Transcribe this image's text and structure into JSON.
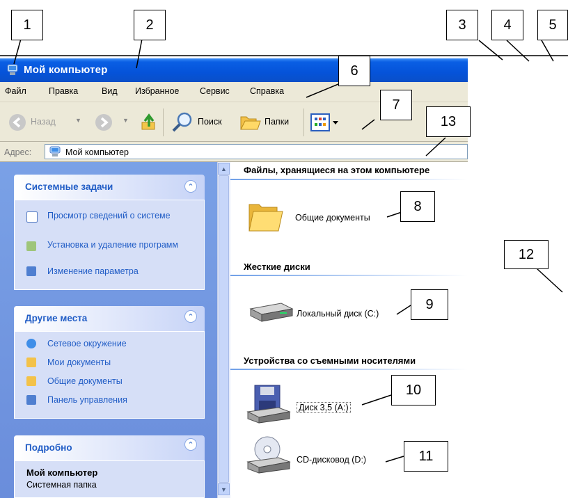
{
  "callouts": [
    "1",
    "2",
    "3",
    "4",
    "5",
    "6",
    "7",
    "8",
    "9",
    "10",
    "11",
    "12",
    "13"
  ],
  "window": {
    "title": "Мой компьютер",
    "menu": [
      "Файл",
      "Правка",
      "Вид",
      "Избранное",
      "Сервис",
      "Справка"
    ],
    "toolbar": {
      "back": "Назад",
      "search": "Поиск",
      "folders": "Папки"
    },
    "address_label": "Адрес:",
    "address_value": "Мой компьютер"
  },
  "tasks": {
    "system": {
      "title": "Системные задачи",
      "items": [
        "Просмотр сведений о системе",
        "Установка и удаление программ",
        "Изменение параметра"
      ]
    },
    "other": {
      "title": "Другие места",
      "items": [
        "Сетевое окружение",
        "Мои документы",
        "Общие документы",
        "Панель управления"
      ]
    },
    "details": {
      "title": "Подробно",
      "name": "Мой компьютер",
      "type": "Системная папка"
    }
  },
  "content": {
    "groups": [
      {
        "title": "Файлы, хранящиеся на этом компьютере",
        "items": [
          "Общие документы"
        ]
      },
      {
        "title": "Жесткие диски",
        "items": [
          "Локальный диск (C:)"
        ]
      },
      {
        "title": "Устройства со съемными носителями",
        "items": [
          "Диск 3,5 (A:)",
          "CD-дисковод (D:)"
        ]
      }
    ]
  },
  "colors": {
    "titlebar": "#0553d9",
    "accent": "#215dc6",
    "panel": "#6a8ddb"
  }
}
